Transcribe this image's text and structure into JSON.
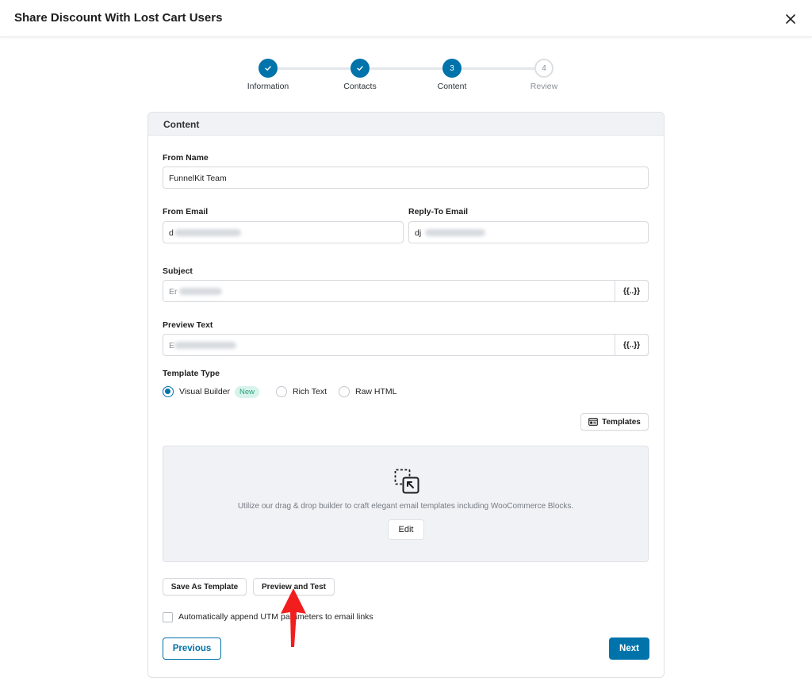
{
  "header": {
    "title": "Share Discount With Lost Cart Users"
  },
  "stepper": {
    "steps": [
      {
        "number": "1",
        "label": "Information",
        "status": "done"
      },
      {
        "number": "2",
        "label": "Contacts",
        "status": "done"
      },
      {
        "number": "3",
        "label": "Content",
        "status": "active"
      },
      {
        "number": "4",
        "label": "Review",
        "status": "todo"
      }
    ]
  },
  "content": {
    "section_title": "Content",
    "from_name": {
      "label": "From Name",
      "value": "FunnelKit Team"
    },
    "from_email": {
      "label": "From Email",
      "value": "d"
    },
    "reply_to_email": {
      "label": "Reply-To Email",
      "value": "dj"
    },
    "subject": {
      "label": "Subject",
      "value": "Er",
      "merge_tag_label": "{{..}}"
    },
    "preview_text": {
      "label": "Preview Text",
      "value": "E",
      "merge_tag_label": "{{..}}"
    },
    "template_type": {
      "label": "Template Type",
      "options": [
        {
          "label": "Visual Builder",
          "badge": "New",
          "checked": true
        },
        {
          "label": "Rich Text",
          "checked": false
        },
        {
          "label": "Raw HTML",
          "checked": false
        }
      ]
    },
    "templates_button": "Templates",
    "builder": {
      "description": "Utilize our drag & drop builder to craft elegant email templates including WooCommerce Blocks.",
      "edit_label": "Edit"
    },
    "save_as_template_label": "Save As Template",
    "preview_and_test_label": "Preview and Test",
    "utm_checkbox": {
      "label": "Automatically append UTM parameters to email links",
      "checked": false
    },
    "previous_label": "Previous",
    "next_label": "Next"
  },
  "colors": {
    "accent": "#0073aa",
    "badge_bg": "#d7f3ec",
    "badge_text": "#2ba07b",
    "annotation_arrow": "#ff0000"
  }
}
